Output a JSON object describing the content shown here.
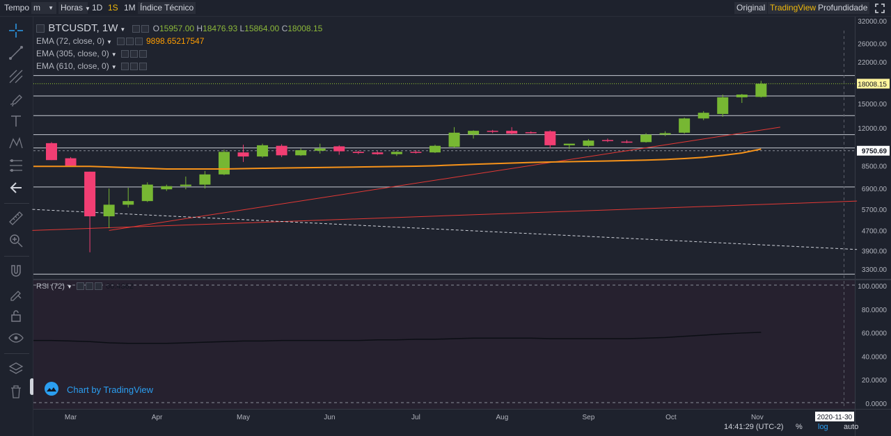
{
  "toolbar": {
    "tempo": "Tempo",
    "minute": "m",
    "hours": "Horas",
    "d1": "1D",
    "s1": "1S",
    "m1": "1M",
    "indicator": "Índice Técnico",
    "original": "Original",
    "tradingview": "TradingView",
    "depth": "Profundidade"
  },
  "legend": {
    "symbol": "BTCUSDT, 1W",
    "o_label": "O",
    "o": "15957.00",
    "h_label": "H",
    "h": "18476.93",
    "l_label": "L",
    "l": "15864.00",
    "c_label": "C",
    "c": "18008.15",
    "ema1_label": "EMA (72, close, 0)",
    "ema1_value": "9898.65217547",
    "ema2_label": "EMA (305, close, 0)",
    "ema3_label": "EMA (610, close, 0)",
    "rsi_label": "RSI (72)",
    "rsi_value": "60.4362"
  },
  "watermark": "Chart by TradingView",
  "footer": {
    "time": "14:41:29 (UTC-2)",
    "percent": "%",
    "log": "log",
    "auto": "auto",
    "date_label": "2020-11-30"
  },
  "colors": {
    "up": "#77b733",
    "down": "#f23e73",
    "ema": "#f7931a",
    "trend": "#e53935",
    "accent": "#f0b90b"
  },
  "chart_data": {
    "type": "candlestick",
    "scale": "log",
    "interval": "1W",
    "price_ticks": [
      32000,
      26000,
      22000,
      18000,
      15000,
      12000,
      10500,
      8500,
      6900,
      5700,
      4700,
      3900,
      3300
    ],
    "price_tick_labels": [
      "32000.00",
      "26000.00",
      "22000.00",
      "",
      "15000.00",
      "12000.00",
      "",
      "8500.00",
      "6900.00",
      "5700.00",
      "4700.00",
      "3900.00",
      "3300.00"
    ],
    "last_price_label": "18008.15",
    "marker_price_label": "9750.69",
    "months": [
      "Mar",
      "Apr",
      "May",
      "Jun",
      "Jul",
      "Aug",
      "Sep",
      "Oct",
      "Nov"
    ],
    "candles": [
      {
        "o": 10450,
        "h": 10550,
        "l": 8950,
        "c": 8950
      },
      {
        "o": 9100,
        "h": 9200,
        "l": 8450,
        "c": 8500
      },
      {
        "o": 8050,
        "h": 8050,
        "l": 3850,
        "c": 5350
      },
      {
        "o": 5350,
        "h": 6900,
        "l": 4800,
        "c": 5950
      },
      {
        "o": 5950,
        "h": 6950,
        "l": 5800,
        "c": 6150
      },
      {
        "o": 6150,
        "h": 7300,
        "l": 6100,
        "c": 7150
      },
      {
        "o": 6850,
        "h": 7150,
        "l": 6750,
        "c": 7050
      },
      {
        "o": 7050,
        "h": 7700,
        "l": 6850,
        "c": 7150
      },
      {
        "o": 7150,
        "h": 8100,
        "l": 6900,
        "c": 7850
      },
      {
        "o": 7850,
        "h": 9850,
        "l": 7800,
        "c": 9650
      },
      {
        "o": 9600,
        "h": 10300,
        "l": 8800,
        "c": 9250
      },
      {
        "o": 9250,
        "h": 10400,
        "l": 9150,
        "c": 10250
      },
      {
        "o": 10200,
        "h": 10350,
        "l": 9200,
        "c": 9350
      },
      {
        "o": 9350,
        "h": 9950,
        "l": 9300,
        "c": 9800
      },
      {
        "o": 9750,
        "h": 10400,
        "l": 9500,
        "c": 9950
      },
      {
        "o": 10150,
        "h": 10250,
        "l": 9400,
        "c": 9700
      },
      {
        "o": 9650,
        "h": 9750,
        "l": 9450,
        "c": 9550
      },
      {
        "o": 9600,
        "h": 9700,
        "l": 9400,
        "c": 9450
      },
      {
        "o": 9450,
        "h": 9700,
        "l": 9300,
        "c": 9650
      },
      {
        "o": 9650,
        "h": 9800,
        "l": 9500,
        "c": 9600
      },
      {
        "o": 9600,
        "h": 10300,
        "l": 9550,
        "c": 10200
      },
      {
        "o": 10100,
        "h": 12100,
        "l": 10000,
        "c": 11500
      },
      {
        "o": 11300,
        "h": 11750,
        "l": 10900,
        "c": 11700
      },
      {
        "o": 11700,
        "h": 11800,
        "l": 11450,
        "c": 11600
      },
      {
        "o": 11700,
        "h": 12100,
        "l": 11300,
        "c": 11400
      },
      {
        "o": 11550,
        "h": 11650,
        "l": 11400,
        "c": 11500
      },
      {
        "o": 11650,
        "h": 11750,
        "l": 9950,
        "c": 10250
      },
      {
        "o": 10250,
        "h": 10350,
        "l": 9900,
        "c": 10400
      },
      {
        "o": 10200,
        "h": 10850,
        "l": 10100,
        "c": 10700
      },
      {
        "o": 10750,
        "h": 10900,
        "l": 10550,
        "c": 10650
      },
      {
        "o": 10600,
        "h": 10750,
        "l": 10450,
        "c": 10550
      },
      {
        "o": 10550,
        "h": 11450,
        "l": 10500,
        "c": 11300
      },
      {
        "o": 11300,
        "h": 11650,
        "l": 11150,
        "c": 11450
      },
      {
        "o": 11500,
        "h": 13200,
        "l": 11400,
        "c": 13100
      },
      {
        "o": 13100,
        "h": 14000,
        "l": 12900,
        "c": 13800
      },
      {
        "o": 13650,
        "h": 16300,
        "l": 13300,
        "c": 15900
      },
      {
        "o": 15900,
        "h": 16400,
        "l": 15100,
        "c": 16300
      },
      {
        "o": 15957,
        "h": 18476.93,
        "l": 15864,
        "c": 18008.15
      }
    ],
    "ema_72": [
      8450,
      8450,
      8450,
      8400,
      8350,
      8300,
      8250,
      8250,
      8250,
      8250,
      8280,
      8300,
      8320,
      8340,
      8360,
      8380,
      8400,
      8420,
      8440,
      8460,
      8500,
      8560,
      8610,
      8660,
      8710,
      8760,
      8790,
      8820,
      8850,
      8880,
      8910,
      8950,
      9000,
      9080,
      9180,
      9350,
      9550,
      9898.65
    ],
    "rsi_72": [
      53.5,
      53,
      52.5,
      51.5,
      51,
      51,
      51,
      51.5,
      52,
      52.5,
      53,
      53,
      53.5,
      53.5,
      53.5,
      53.5,
      53.5,
      54,
      54,
      54.5,
      54.5,
      55,
      55.5,
      55.5,
      55.5,
      55.5,
      55,
      55,
      55,
      55,
      55,
      55.5,
      56,
      57,
      58,
      59,
      59.8,
      60.4362
    ],
    "rsi_ticks": [
      "100.0000",
      "80.0000",
      "60.0000",
      "40.0000",
      "20.0000",
      "0.0000"
    ],
    "horizontal_levels": [
      19400,
      16100,
      13450,
      11300,
      10000,
      7000,
      3150
    ]
  }
}
